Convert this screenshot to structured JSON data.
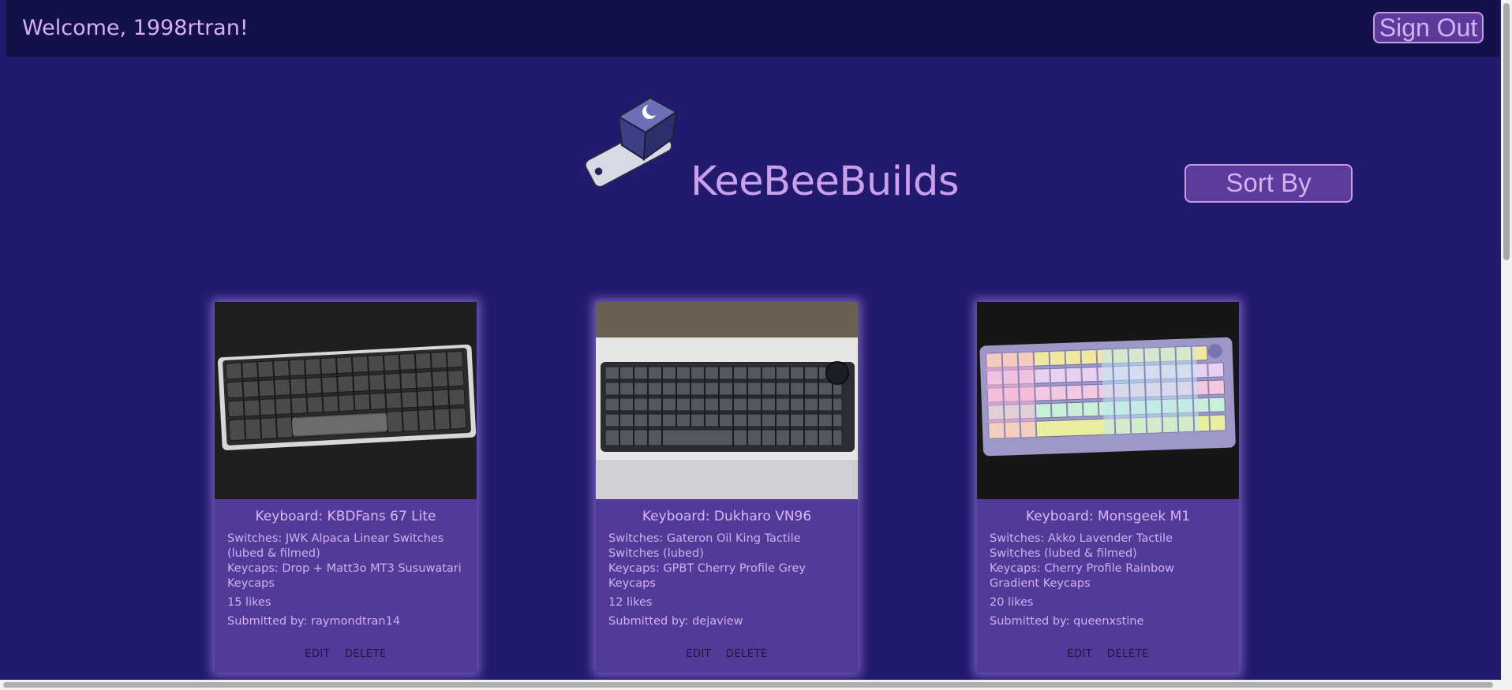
{
  "header": {
    "welcome": "Welcome, 1998rtran!",
    "sign_out_label": "Sign Out"
  },
  "brand": {
    "title": "KeeBeeBuilds",
    "logo_icon": "keycap-keychain-logo"
  },
  "controls": {
    "sort_label": "Sort By"
  },
  "colors": {
    "background": "#221a6e",
    "topbar": "#14104a",
    "card": "#523a98",
    "accent_text": "#c9a0ee"
  },
  "cards": [
    {
      "title": "Keyboard: KBDFans 67 Lite",
      "switches": "Switches: JWK Alpaca Linear Switches (lubed & filmed)",
      "keycaps": "Keycaps: Drop + Matt3o MT3 Susuwatari Keycaps",
      "likes": "15 likes",
      "submitted": "Submitted by: raymondtran14",
      "edit_label": "EDIT",
      "delete_label": "DELETE"
    },
    {
      "title": "Keyboard: Dukharo VN96",
      "switches": "Switches: Gateron Oil King Tactile Switches (lubed)",
      "keycaps": "Keycaps: GPBT Cherry Profile Grey Keycaps",
      "likes": "12 likes",
      "submitted": "Submitted by: dejaview",
      "edit_label": "EDIT",
      "delete_label": "DELETE"
    },
    {
      "title": "Keyboard: Monsgeek M1",
      "switches": "Switches: Akko Lavender Tactile Switches (lubed & filmed)",
      "keycaps": "Keycaps: Cherry Profile Rainbow Gradient Keycaps",
      "likes": "20 likes",
      "submitted": "Submitted by: queenxstine",
      "edit_label": "EDIT",
      "delete_label": "DELETE"
    }
  ]
}
